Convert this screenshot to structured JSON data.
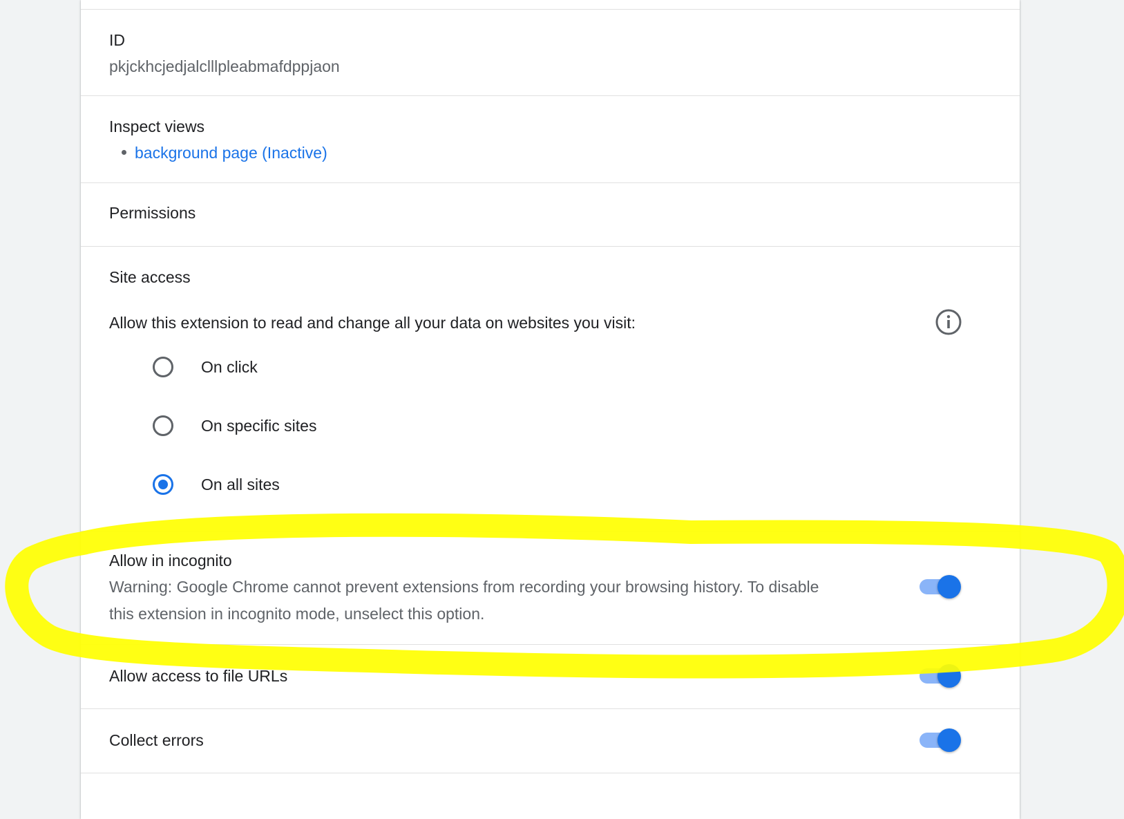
{
  "details": {
    "id_label": "ID",
    "id_value": "pkjckhcjedjalclllpleabmafdppjaon",
    "inspect_views_label": "Inspect views",
    "inspect_views_link": "background page (Inactive)",
    "permissions_label": "Permissions",
    "site_access": {
      "title": "Site access",
      "description": "Allow this extension to read and change all your data on websites you visit:",
      "info_icon": "info-icon",
      "options": [
        {
          "label": "On click",
          "checked": false
        },
        {
          "label": "On specific sites",
          "checked": false
        },
        {
          "label": "On all sites",
          "checked": true
        }
      ]
    },
    "incognito": {
      "label": "Allow in incognito",
      "warning_line1": "Warning: Google Chrome cannot prevent extensions from recording your browsing history. To disable",
      "warning_line2": "this extension in incognito mode, unselect this option.",
      "enabled": true
    },
    "file_urls": {
      "label": "Allow access to file URLs",
      "enabled": true
    },
    "collect_errors": {
      "label": "Collect errors",
      "enabled": true
    }
  },
  "colors": {
    "accent": "#1a73e8",
    "toggle_track": "#8ab4f8",
    "highlight_annotation": "#ffff00",
    "secondary_text": "#5f6368"
  }
}
